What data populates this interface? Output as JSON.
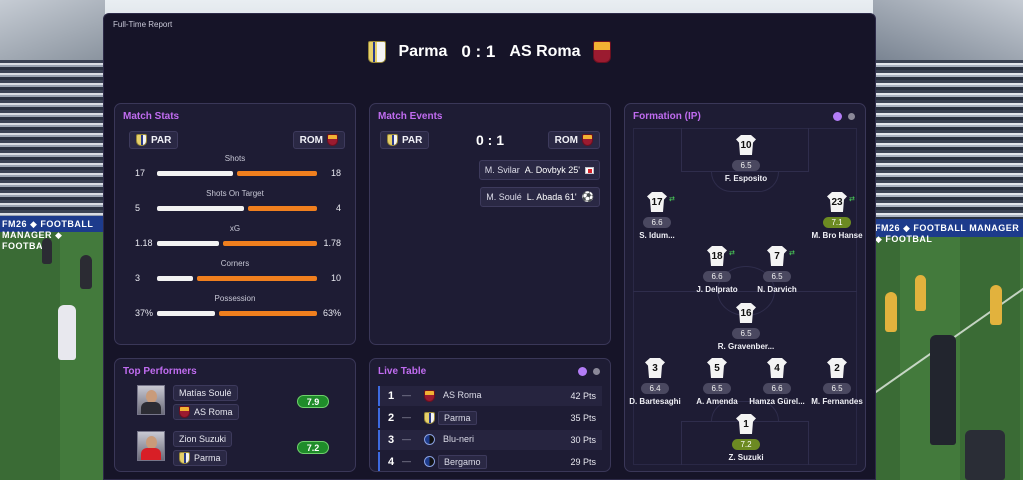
{
  "report": {
    "label": "Full-Time Report"
  },
  "match": {
    "home": "Parma",
    "away": "AS Roma",
    "score": "0 : 1"
  },
  "backdrop": {
    "ad_left": "FM26 ◆ FOOTBALL MANAGER ◆ FOOTBA",
    "ad_right": "FM26 ◆ FOOTBALL MANAGER ◆ FOOTBAL"
  },
  "colors": {
    "accent": "#c06cf0",
    "home_bar": "#f2f2f2",
    "away_bar": "#f07f1e",
    "rating_green": "#1f8c2a"
  },
  "stats": {
    "title": "Match Stats",
    "home_abbr": "PAR",
    "away_abbr": "ROM",
    "rows": [
      {
        "label": "Shots",
        "home": "17",
        "away": "18",
        "home_share": 0.486
      },
      {
        "label": "Shots On Target",
        "home": "5",
        "away": "4",
        "home_share": 0.556
      },
      {
        "label": "xG",
        "home": "1.18",
        "away": "1.78",
        "home_share": 0.399
      },
      {
        "label": "Corners",
        "home": "3",
        "away": "10",
        "home_share": 0.231
      },
      {
        "label": "Possession",
        "home": "37%",
        "away": "63%",
        "home_share": 0.37
      }
    ]
  },
  "events": {
    "title": "Match Events",
    "home_abbr": "PAR",
    "away_abbr": "ROM",
    "score": "0 : 1",
    "list": [
      {
        "assist": "M. Svilar",
        "text": "A. Dovbyk 25'",
        "icon": "red-card-icon"
      },
      {
        "assist": "M. Soulé",
        "text": "L. Abada 61'",
        "icon": "ball-icon"
      }
    ]
  },
  "performers": {
    "title": "Top Performers",
    "list": [
      {
        "name": "Matías Soulé",
        "team": "AS Roma",
        "rating": "7.9",
        "kit": "#9b1b30"
      },
      {
        "name": "Zion Suzuki",
        "team": "Parma",
        "rating": "7.2",
        "kit": "#d81f26"
      }
    ]
  },
  "live_table": {
    "title": "Live Table",
    "rows": [
      {
        "pos": "1",
        "move": "—",
        "team": "AS Roma",
        "pts": "42 Pts"
      },
      {
        "pos": "2",
        "move": "—",
        "team": "Parma",
        "pts": "35 Pts"
      },
      {
        "pos": "3",
        "move": "—",
        "team": "Blu-neri",
        "pts": "30 Pts"
      },
      {
        "pos": "4",
        "move": "—",
        "team": "Bergamo",
        "pts": "29 Pts"
      }
    ]
  },
  "formation": {
    "title": "Formation (IP)",
    "players": [
      {
        "num": "10",
        "rating": "6.5",
        "name": "F. Esposito"
      },
      {
        "num": "17",
        "rating": "6.6",
        "name": "S. Idum...",
        "sub": true
      },
      {
        "num": "23",
        "rating": "7.1",
        "name": "M. Bro Hanse",
        "good": true,
        "sub": true
      },
      {
        "num": "18",
        "rating": "6.6",
        "name": "J. Delprato",
        "sub": true
      },
      {
        "num": "7",
        "rating": "6.5",
        "name": "N. Darvich",
        "sub": true
      },
      {
        "num": "16",
        "rating": "6.5",
        "name": "R. Gravenber..."
      },
      {
        "num": "3",
        "rating": "6.4",
        "name": "D. Bartesaghi"
      },
      {
        "num": "5",
        "rating": "6.5",
        "name": "A. Amenda"
      },
      {
        "num": "4",
        "rating": "6.6",
        "name": "Hamza Gürel..."
      },
      {
        "num": "2",
        "rating": "6.5",
        "name": "M. Fernandes"
      },
      {
        "num": "1",
        "rating": "7.2",
        "name": "Z. Suzuki",
        "good": true
      }
    ]
  }
}
